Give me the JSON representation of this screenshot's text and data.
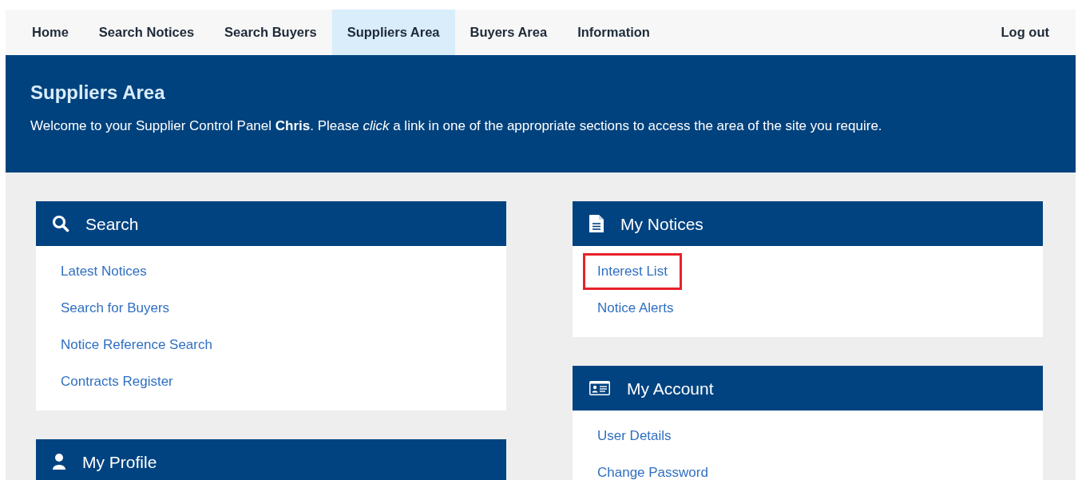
{
  "nav": {
    "items": [
      {
        "label": "Home",
        "selected": false
      },
      {
        "label": "Search Notices",
        "selected": false
      },
      {
        "label": "Search Buyers",
        "selected": false
      },
      {
        "label": "Suppliers Area",
        "selected": true
      },
      {
        "label": "Buyers Area",
        "selected": false
      },
      {
        "label": "Information",
        "selected": false
      }
    ],
    "logout": "Log out"
  },
  "banner": {
    "title": "Suppliers Area",
    "text": "Welcome to your Supplier Control Panel **Chris**. Please *click* a link in one of the appropriate sections to access the area of the site you require."
  },
  "columns": [
    [
      {
        "title": "Search",
        "kind": "search",
        "links": [
          {
            "label": "Latest Notices",
            "highlighted": false
          },
          {
            "label": "Search for Buyers",
            "highlighted": false
          },
          {
            "label": "Notice Reference Search",
            "highlighted": false
          },
          {
            "label": "Contracts Register",
            "highlighted": false
          }
        ]
      },
      {
        "title": "My Profile",
        "kind": "person"
      }
    ],
    [
      {
        "title": "My Notices",
        "kind": "document",
        "links": [
          {
            "label": "Interest List",
            "highlighted": true
          },
          {
            "label": "Notice Alerts",
            "highlighted": false
          }
        ]
      },
      {
        "title": "My Account",
        "kind": "idcard",
        "links": [
          {
            "label": "User Details",
            "highlighted": false
          },
          {
            "label": "Change Password",
            "highlighted": false
          }
        ]
      }
    ]
  ]
}
